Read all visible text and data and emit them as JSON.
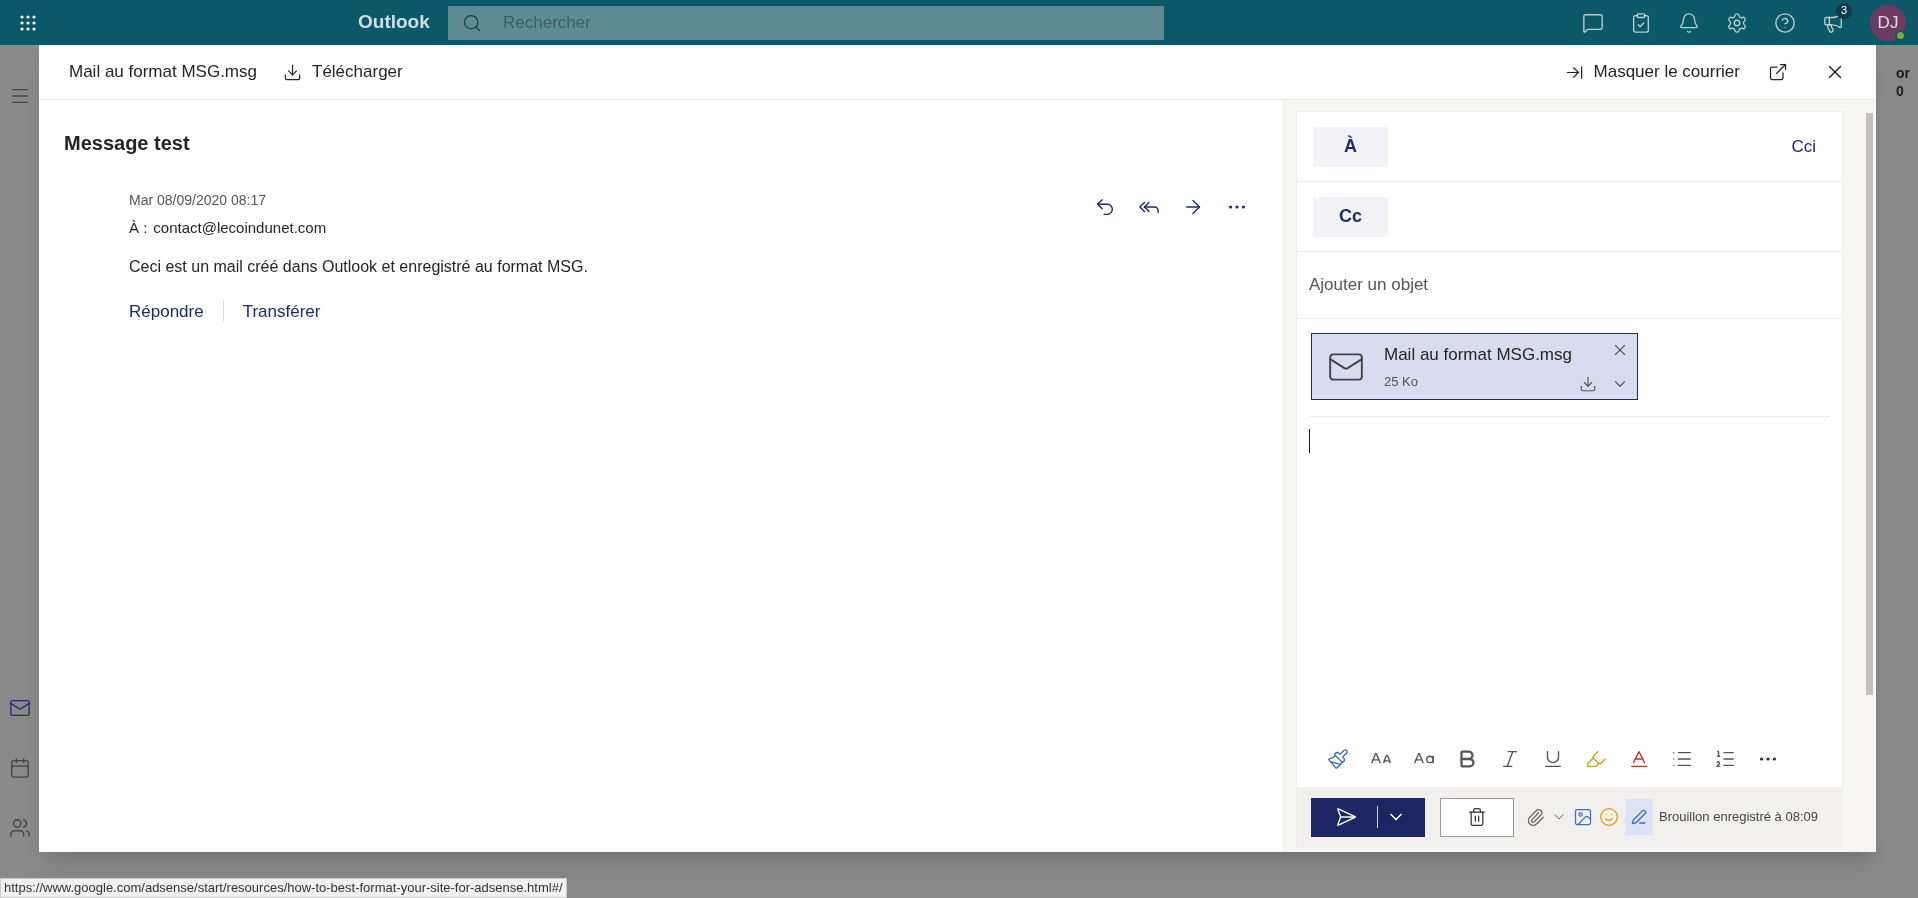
{
  "topbar": {
    "app_name": "Outlook",
    "search": {
      "placeholder": "Rechercher"
    },
    "notification_count": "3",
    "avatar": "DJ"
  },
  "background_edge_texts": [
    "or",
    "0"
  ],
  "viewer": {
    "file_name": "Mail au format MSG.msg",
    "download": "Télécharger",
    "hide_mail": "Masquer le courrier"
  },
  "message": {
    "subject": "Message test",
    "date": "Mar 08/09/2020 08:17",
    "to_label": "À :",
    "to": "contact@lecoindunet.com",
    "body": "Ceci est un mail créé dans Outlook et enregistré au format MSG.",
    "actions": [
      "Répondre",
      "Transférer"
    ]
  },
  "compose": {
    "to_label": "À",
    "bcc": "Cci",
    "cc_label": "Cc",
    "subject": {
      "placeholder": "Ajouter un objet"
    },
    "attachment": {
      "name": "Mail au format MSG.msg",
      "size": "25 Ko"
    },
    "draft_status": "Brouillon enregistré à 08:09"
  },
  "status_url": "https://www.google.com/adsense/start/resources/how-to-best-format-your-site-for-adsense.html#/"
}
